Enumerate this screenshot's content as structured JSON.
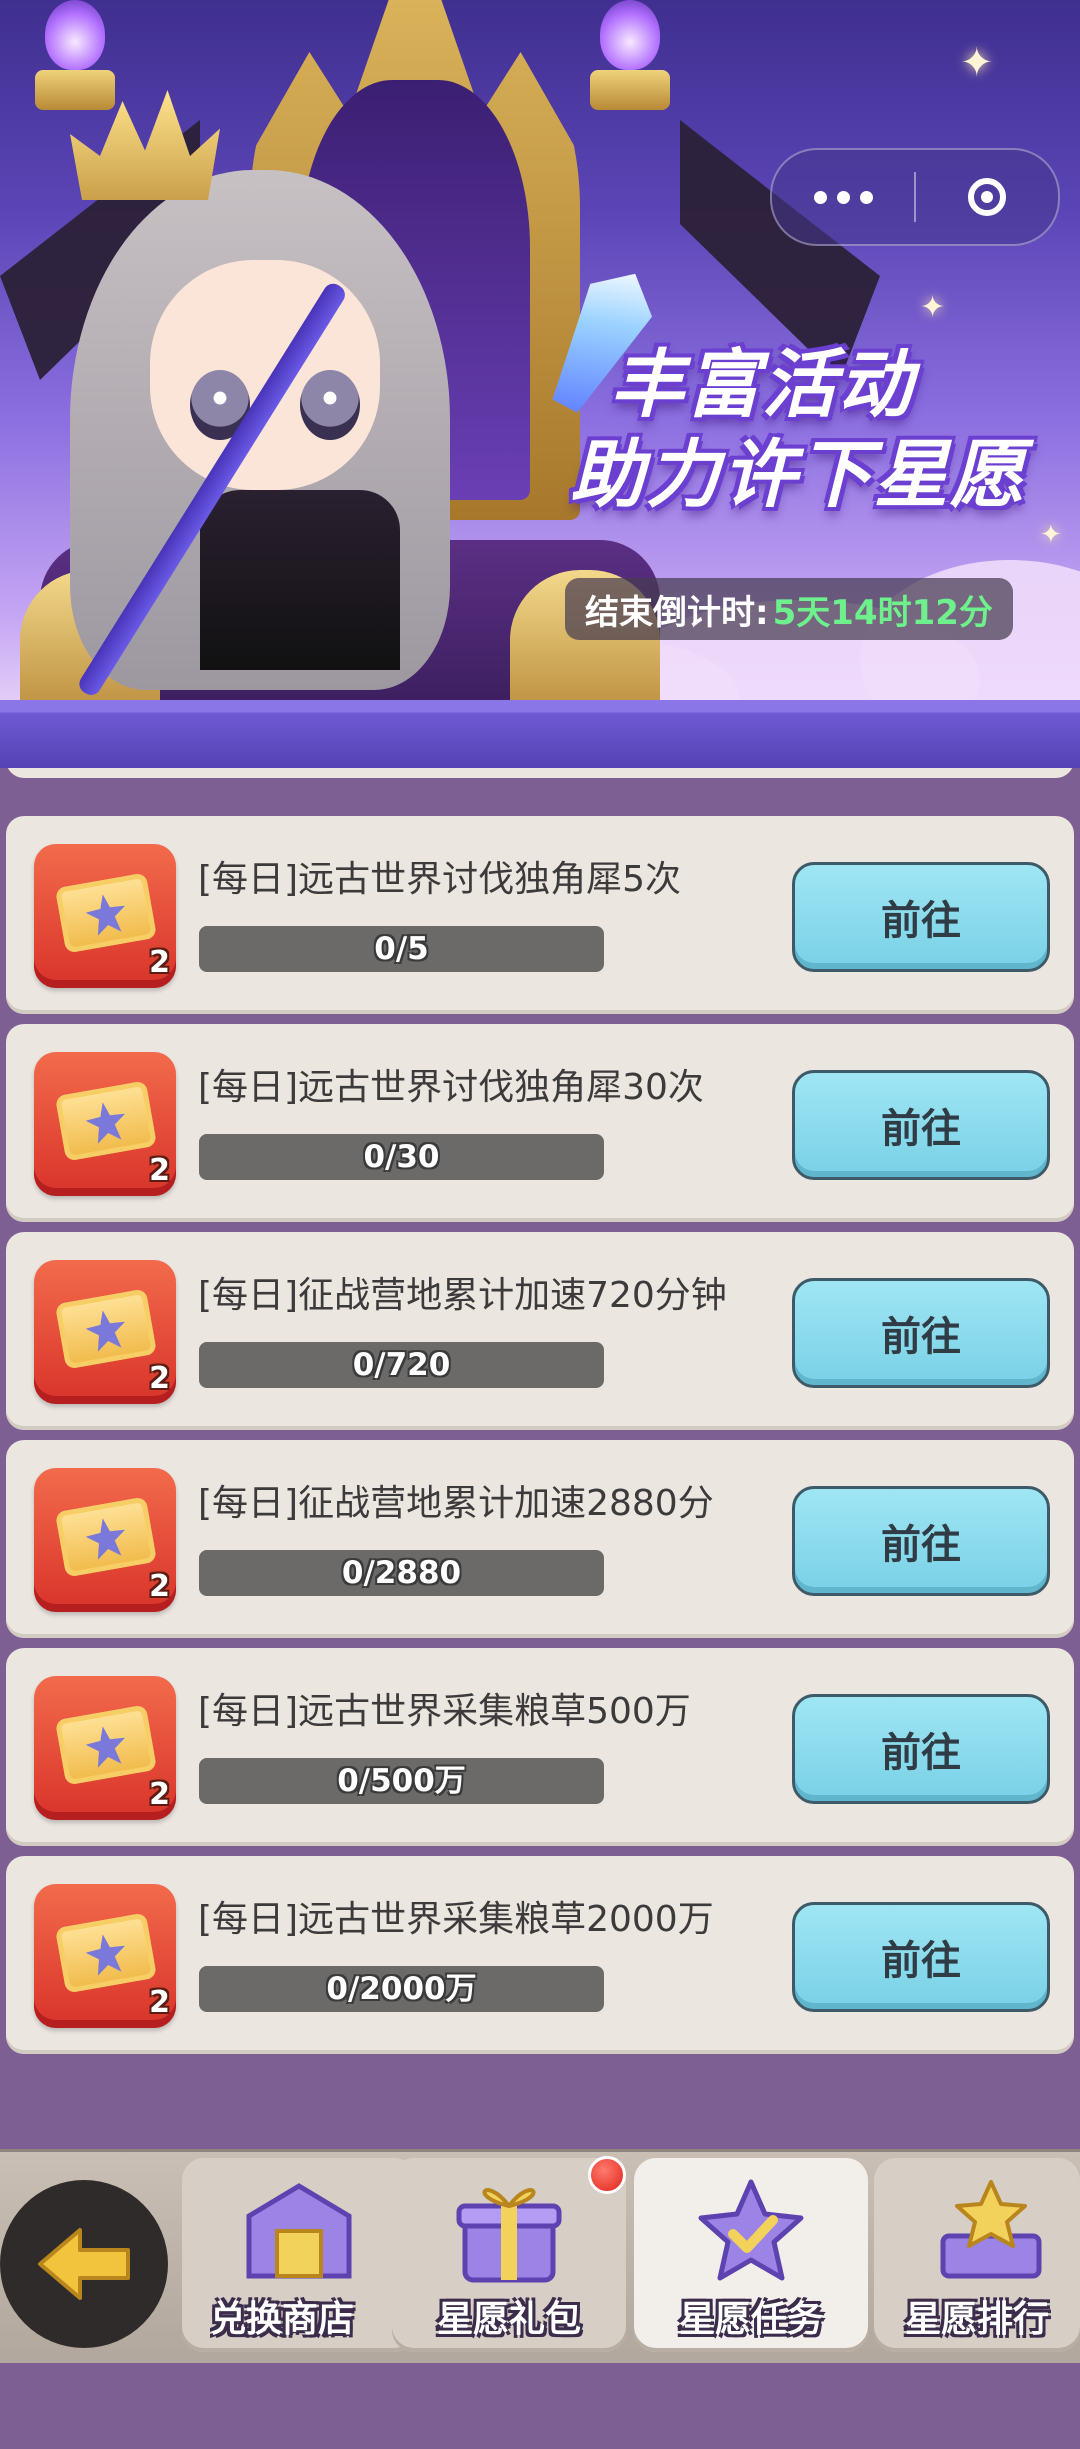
{
  "banner": {
    "title_line1": "丰富活动",
    "title_line2": "助力许下星愿",
    "countdown_label": "结束倒计时:",
    "countdown_value": "5天14时12分"
  },
  "capsule": {
    "more_icon": "more-dots-icon",
    "close_icon": "target-close-icon"
  },
  "tasks": [
    {
      "title": "[每日]远古世界讨伐独角犀5次",
      "progress_text": "0/5",
      "progress": 0,
      "reward_qty": "2",
      "button": "前往"
    },
    {
      "title": "[每日]远古世界讨伐独角犀30次",
      "progress_text": "0/30",
      "progress": 0,
      "reward_qty": "2",
      "button": "前往"
    },
    {
      "title": "[每日]征战营地累计加速720分钟",
      "progress_text": "0/720",
      "progress": 0,
      "reward_qty": "2",
      "button": "前往"
    },
    {
      "title": "[每日]征战营地累计加速2880分",
      "progress_text": "0/2880",
      "progress": 0,
      "reward_qty": "2",
      "button": "前往"
    },
    {
      "title": "[每日]远古世界采集粮草500万",
      "progress_text": "0/500万",
      "progress": 0,
      "reward_qty": "2",
      "button": "前往"
    },
    {
      "title": "[每日]远古世界采集粮草2000万",
      "progress_text": "0/2000万",
      "progress": 0,
      "reward_qty": "2",
      "button": "前往"
    }
  ],
  "nav": {
    "back_icon": "arrow-left-icon",
    "tabs": [
      {
        "label": "兑换商店",
        "icon": "shop-icon",
        "active": false
      },
      {
        "label": "星愿礼包",
        "icon": "gift-icon",
        "active": false
      },
      {
        "label": "星愿任务",
        "icon": "task-star-icon",
        "active": true
      },
      {
        "label": "星愿排行",
        "icon": "rank-trophy-icon",
        "active": false
      }
    ]
  },
  "colors": {
    "accent_green": "#6ef08c",
    "go_button": "#8edcee",
    "reward_red": "#e2452f"
  }
}
